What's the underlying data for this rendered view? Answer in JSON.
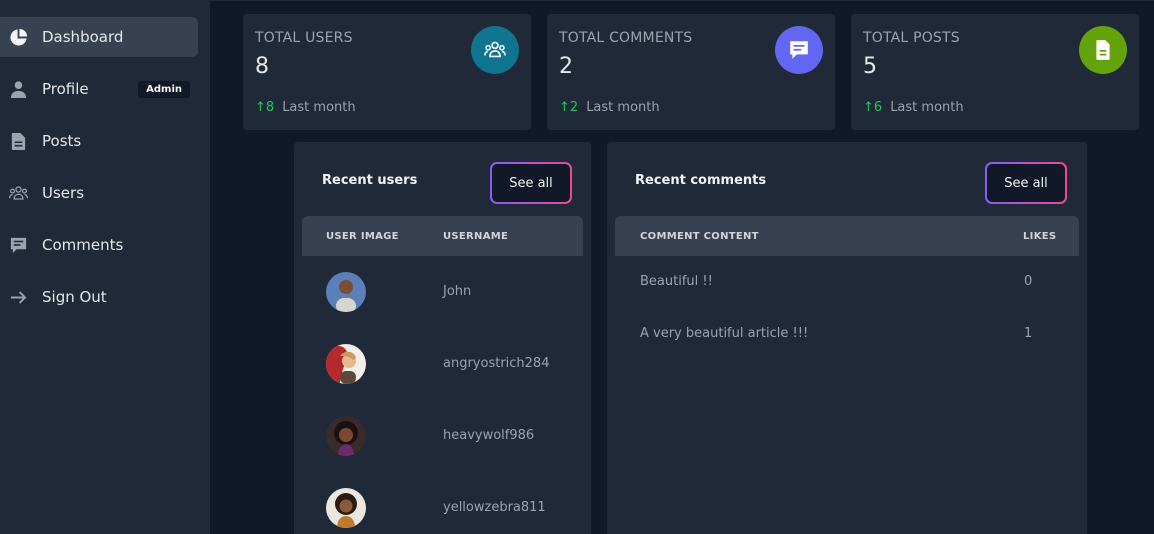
{
  "sidebar": {
    "items": [
      {
        "label": "Dashboard",
        "icon": "pie-chart-icon"
      },
      {
        "label": "Profile",
        "icon": "user-icon",
        "badge": "Admin"
      },
      {
        "label": "Posts",
        "icon": "document-icon"
      },
      {
        "label": "Users",
        "icon": "users-icon"
      },
      {
        "label": "Comments",
        "icon": "comment-icon"
      },
      {
        "label": "Sign Out",
        "icon": "arrow-right-icon"
      }
    ]
  },
  "stats": [
    {
      "title": "TOTAL USERS",
      "value": "8",
      "trend_value": "8",
      "trend_label": "Last month",
      "icon": "users-group-icon",
      "color": "#0e7490"
    },
    {
      "title": "TOTAL COMMENTS",
      "value": "2",
      "trend_value": "2",
      "trend_label": "Last month",
      "icon": "chat-icon",
      "color": "#6366f1"
    },
    {
      "title": "TOTAL POSTS",
      "value": "5",
      "trend_value": "6",
      "trend_label": "Last month",
      "icon": "document-icon",
      "color": "#65a30d"
    }
  ],
  "recent_users": {
    "title": "Recent users",
    "see_all": "See all",
    "columns": [
      "USER IMAGE",
      "USERNAME"
    ],
    "rows": [
      {
        "username": "John"
      },
      {
        "username": "angryostrich284"
      },
      {
        "username": "heavywolf986"
      },
      {
        "username": "yellowzebra811"
      }
    ]
  },
  "recent_comments": {
    "title": "Recent comments",
    "see_all": "See all",
    "columns": [
      "COMMENT CONTENT",
      "LIKES"
    ],
    "rows": [
      {
        "content": "Beautiful !!",
        "likes": "0"
      },
      {
        "content": "A very beautiful article !!!",
        "likes": "1"
      }
    ]
  }
}
